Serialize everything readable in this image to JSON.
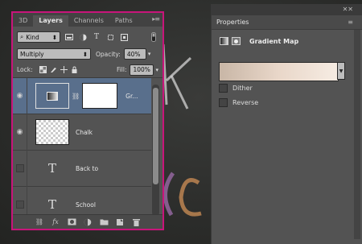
{
  "colors": {
    "accent": "#c8157a",
    "selected_row": "#596f8c"
  },
  "layers_panel": {
    "tabs": [
      "3D",
      "Layers",
      "Channels",
      "Paths"
    ],
    "active_tab": "Layers",
    "filter_kind": "Kind",
    "blend_mode": "Multiply",
    "opacity_label": "Opacity:",
    "opacity_value": "40%",
    "lock_label": "Lock:",
    "fill_label": "Fill:",
    "fill_value": "100%",
    "layers": [
      {
        "name": "Gr...",
        "visible": true,
        "selected": true,
        "kind": "adjustment"
      },
      {
        "name": "Chalk",
        "visible": true,
        "selected": false,
        "kind": "pixel"
      },
      {
        "name": "Back to",
        "visible": false,
        "selected": false,
        "kind": "text"
      },
      {
        "name": "School",
        "visible": false,
        "selected": false,
        "kind": "text"
      }
    ],
    "footer_icons": [
      "link-icon",
      "fx-icon",
      "mask-icon",
      "adjustment-icon",
      "folder-icon",
      "new-layer-icon",
      "trash-icon"
    ],
    "fx_label": "fx"
  },
  "properties_panel": {
    "title": "Properties",
    "adjustment_name": "Gradient Map",
    "dither_label": "Dither",
    "reverse_label": "Reverse",
    "gradient_colors": [
      "#c8b6a6",
      "#f6ece3"
    ]
  },
  "glyphs": {
    "text_layer": "T",
    "eye": "◉",
    "close": "✕✕"
  }
}
